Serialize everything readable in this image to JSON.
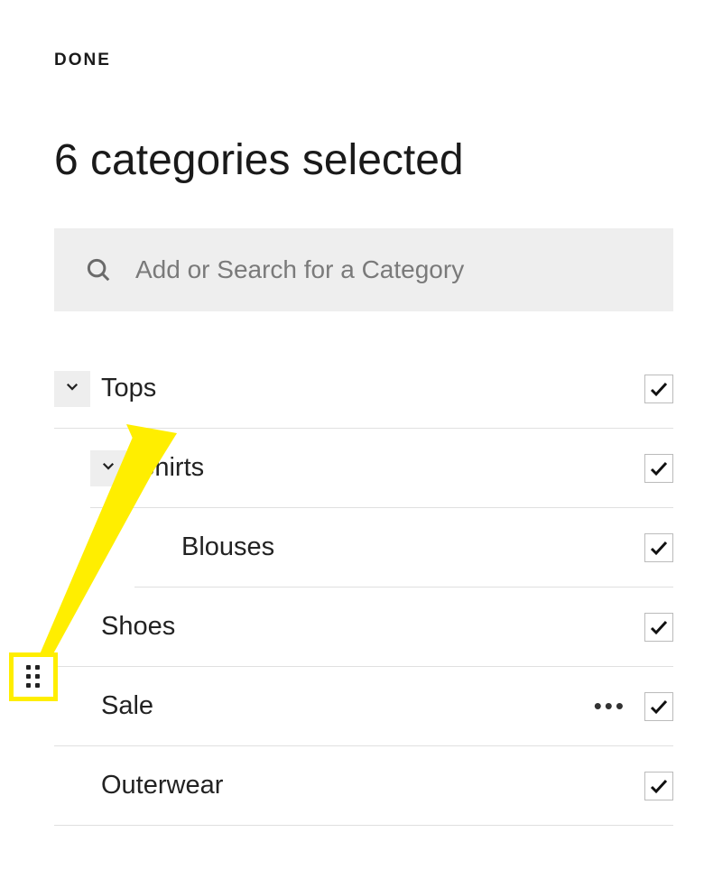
{
  "header": {
    "done_label": "DONE"
  },
  "title": "6 categories selected",
  "search": {
    "placeholder": "Add or Search for a Category"
  },
  "categories": {
    "tops": {
      "label": "Tops",
      "checked": true
    },
    "shirts": {
      "label": "Shirts",
      "checked": true
    },
    "blouses": {
      "label": "Blouses",
      "checked": true
    },
    "shoes": {
      "label": "Shoes",
      "checked": true
    },
    "sale": {
      "label": "Sale",
      "checked": true
    },
    "outerwear": {
      "label": "Outerwear",
      "checked": true
    }
  }
}
